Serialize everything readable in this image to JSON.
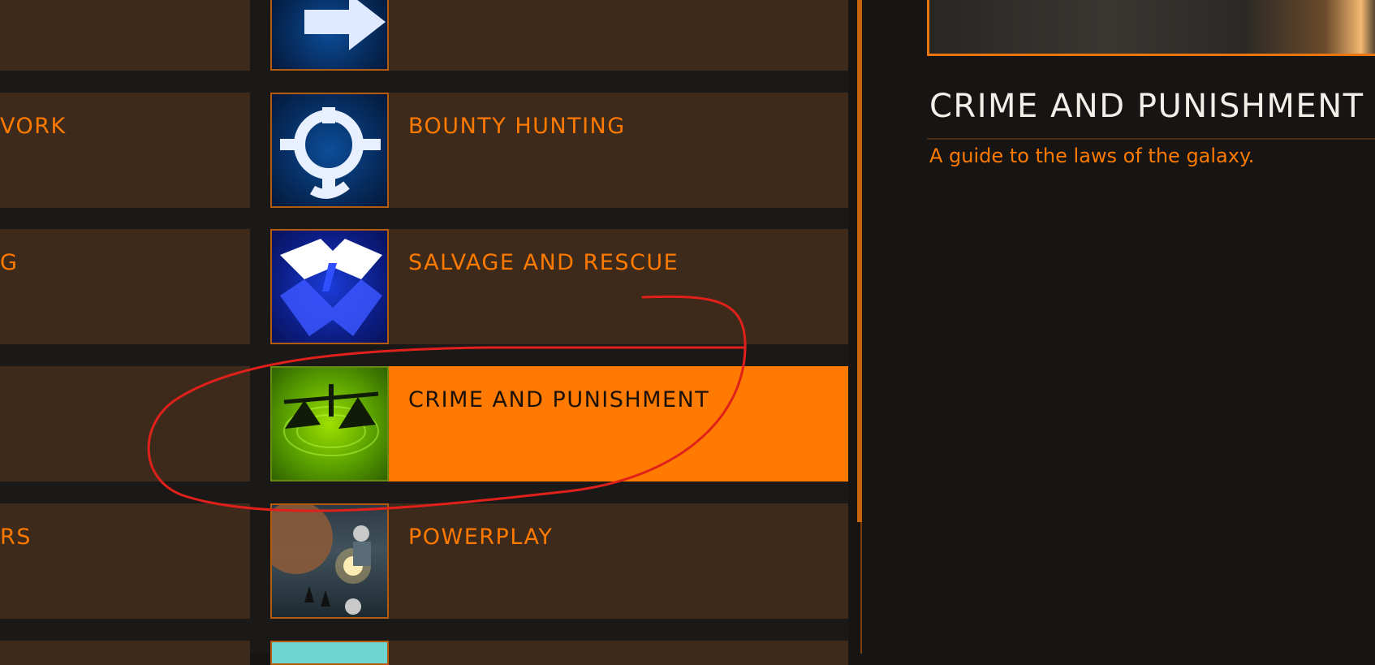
{
  "left_column": {
    "items": [
      {
        "label": "",
        "id": "left-row-1"
      },
      {
        "label": "VORK",
        "id": "left-row-2"
      },
      {
        "label": "G",
        "id": "left-row-3"
      },
      {
        "label": "",
        "id": "left-row-4"
      },
      {
        "label": "RS",
        "id": "left-row-5"
      },
      {
        "label": "",
        "id": "left-row-6"
      }
    ]
  },
  "guide_list": {
    "items": [
      {
        "label": "",
        "icon": "arrow-icon"
      },
      {
        "label": "BOUNTY HUNTING",
        "icon": "crosshair-icon"
      },
      {
        "label": "SALVAGE AND RESCUE",
        "icon": "salvage-icon"
      },
      {
        "label": "CRIME AND PUNISHMENT",
        "icon": "scales-icon",
        "selected": true
      },
      {
        "label": "POWERPLAY",
        "icon": "powerplay-art-icon"
      },
      {
        "label": "",
        "icon": "teal-tile-icon"
      }
    ]
  },
  "detail": {
    "title": "CRIME AND PUNISHMENT",
    "description": "A guide to the laws of the galaxy."
  },
  "colors": {
    "accent": "#ff7a00",
    "card_bg": "#3d2a1a",
    "annotation": "#e0201a"
  }
}
